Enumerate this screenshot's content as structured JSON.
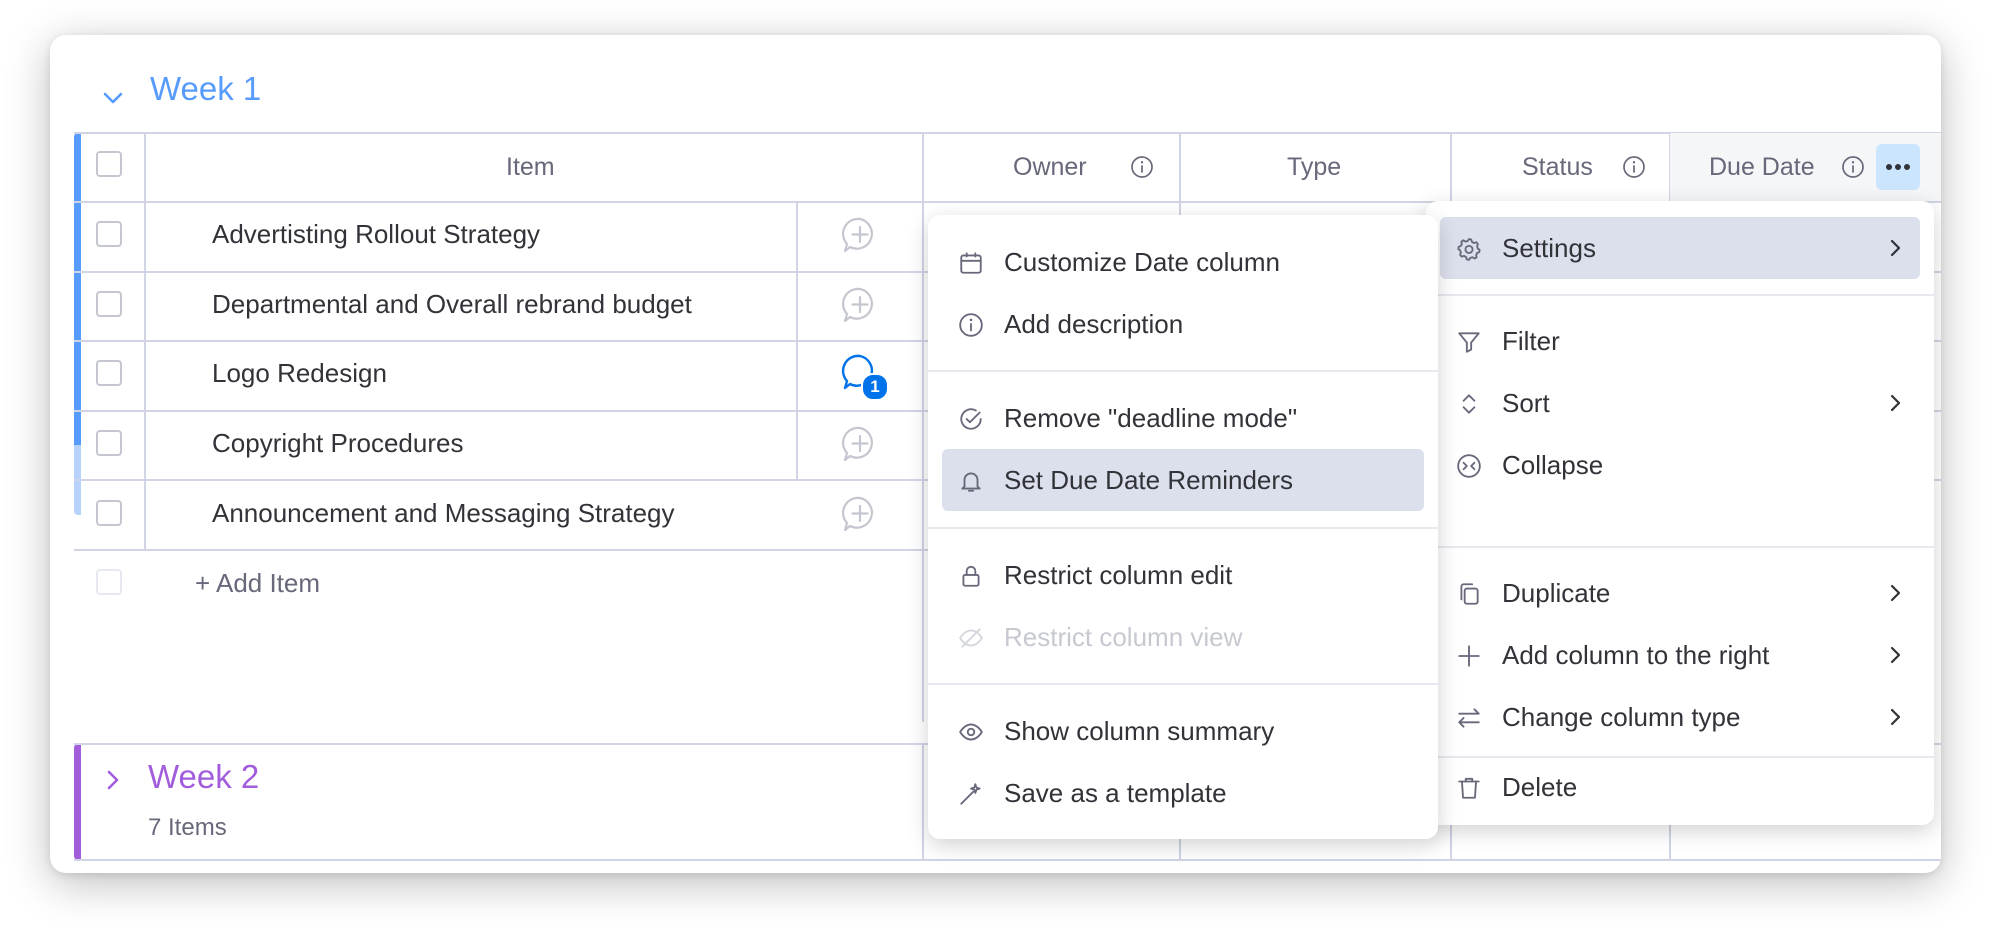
{
  "groups": [
    {
      "title": "Week 1",
      "color": "#579bfc"
    },
    {
      "title": "Week 2",
      "color": "#a25ddc",
      "count_text": "7 Items"
    }
  ],
  "columns": {
    "item": "Item",
    "owner": "Owner",
    "type": "Type",
    "status": "Status",
    "due_date": "Due Date"
  },
  "rows": [
    {
      "name": "Advertisting Rollout Strategy",
      "comments": null
    },
    {
      "name": "Departmental and Overall rebrand budget",
      "comments": null
    },
    {
      "name": "Logo Redesign",
      "comments": "1"
    },
    {
      "name": "Copyright Procedures",
      "comments": null
    },
    {
      "name": "Announcement and Messaging Strategy",
      "comments": null
    }
  ],
  "add_item_label": "+ Add Item",
  "column_menu": {
    "items": [
      {
        "label": "Settings",
        "icon": "gear-icon",
        "submenu": true,
        "active": true
      },
      {
        "label": "Filter",
        "icon": "filter-icon"
      },
      {
        "label": "Sort",
        "icon": "sort-icon",
        "submenu": true
      },
      {
        "label": "Collapse",
        "icon": "collapse-icon"
      },
      {
        "label": "Duplicate",
        "icon": "duplicate-icon",
        "submenu": true
      },
      {
        "label": "Add column to the right",
        "icon": "plus-icon",
        "submenu": true
      },
      {
        "label": "Change column type",
        "icon": "swap-icon",
        "submenu": true
      },
      {
        "label": "Delete",
        "icon": "trash-icon"
      }
    ]
  },
  "settings_submenu": {
    "items": [
      {
        "label": "Customize Date column",
        "icon": "calendar-icon"
      },
      {
        "label": "Add description",
        "icon": "info-icon"
      },
      {
        "label": "Remove \"deadline mode\"",
        "icon": "check-circle-icon"
      },
      {
        "label": "Set Due Date Reminders",
        "icon": "bell-icon",
        "active": true
      },
      {
        "label": "Restrict column edit",
        "icon": "lock-icon"
      },
      {
        "label": "Restrict column view",
        "icon": "eye-off-icon",
        "disabled": true
      },
      {
        "label": "Show column summary",
        "icon": "eye-icon"
      },
      {
        "label": "Save as a template",
        "icon": "magic-wand-icon"
      }
    ]
  },
  "colors": {
    "accent": "#0073ea",
    "menu_active": "#dcdfec",
    "border": "#d0d4e4"
  }
}
